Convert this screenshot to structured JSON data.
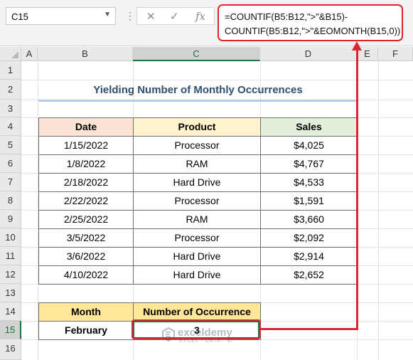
{
  "formula_bar": {
    "name_box": "C15",
    "dots": "⋮",
    "cancel_icon": "✕",
    "enter_icon": "✓",
    "fx_label": "fx",
    "formula_line1": "=COUNTIF(B5:B12,\">\"&B15)-",
    "formula_line2": "COUNTIF(B5:B12,\">\"&EOMONTH(B15,0))"
  },
  "columns": [
    "A",
    "B",
    "C",
    "D",
    "E",
    "F"
  ],
  "rows": [
    "1",
    "2",
    "3",
    "4",
    "5",
    "6",
    "7",
    "8",
    "9",
    "10",
    "11",
    "12",
    "13",
    "14",
    "15",
    "16"
  ],
  "selected_cell": {
    "column": "C",
    "row": "15"
  },
  "title": "Yielding Number of Monthly Occurrences",
  "sales_table": {
    "headers": {
      "date": "Date",
      "product": "Product",
      "sales": "Sales"
    },
    "rows": [
      {
        "date": "1/15/2022",
        "product": "Processor",
        "sales": "$4,025"
      },
      {
        "date": "1/8/2022",
        "product": "RAM",
        "sales": "$4,767"
      },
      {
        "date": "2/18/2022",
        "product": "Hard Drive",
        "sales": "$4,533"
      },
      {
        "date": "2/22/2022",
        "product": "Processor",
        "sales": "$1,591"
      },
      {
        "date": "2/25/2022",
        "product": "RAM",
        "sales": "$3,660"
      },
      {
        "date": "3/5/2022",
        "product": "Processor",
        "sales": "$2,092"
      },
      {
        "date": "3/6/2022",
        "product": "Hard Drive",
        "sales": "$2,914"
      },
      {
        "date": "4/10/2022",
        "product": "Hard Drive",
        "sales": "$2,652"
      }
    ]
  },
  "result_table": {
    "headers": {
      "month": "Month",
      "count": "Number of Occurrence"
    },
    "row": {
      "month": "February",
      "count": "3"
    }
  },
  "watermark": {
    "name": "exceldemy",
    "tagline": "EXCEL · DATA · BI"
  },
  "colors": {
    "accent_red": "#e0252a",
    "selection_green": "#217346",
    "date_header_bg": "#fbe4d5",
    "product_header_bg": "#fff2cc",
    "sales_header_bg": "#e2efda",
    "result_header_bg": "#ffe699",
    "title_text": "#2f4f6f"
  }
}
